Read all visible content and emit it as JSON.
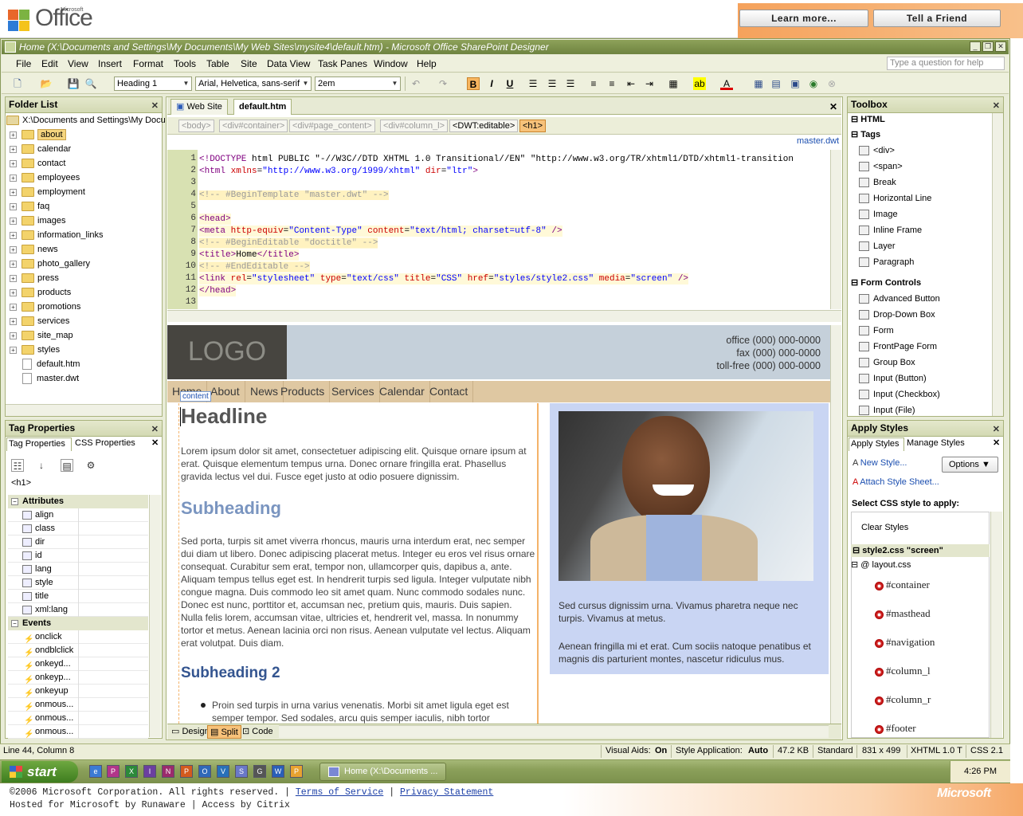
{
  "banner": {
    "logo_text": "Office",
    "logo_small": "Microsoft",
    "learn_more": "Learn more...",
    "tell_friend": "Tell a Friend"
  },
  "window": {
    "title": "Home (X:\\Documents and Settings\\My Documents\\My Web Sites\\mysite4\\default.htm) - Microsoft Office SharePoint Designer"
  },
  "menu": [
    "File",
    "Edit",
    "View",
    "Insert",
    "Format",
    "Tools",
    "Table",
    "Site",
    "Data View",
    "Task Panes",
    "Window",
    "Help"
  ],
  "help_placeholder": "Type a question for help",
  "toolbar": {
    "style": "Heading 1",
    "font": "Arial, Helvetica, sans-serif",
    "size": "2em"
  },
  "folder_list": {
    "title": "Folder List",
    "root": "X:\\Documents and Settings\\My Docu",
    "folders": [
      "about",
      "calendar",
      "contact",
      "employees",
      "employment",
      "faq",
      "images",
      "information_links",
      "news",
      "photo_gallery",
      "press",
      "products",
      "promotions",
      "services",
      "site_map",
      "styles"
    ],
    "files": [
      "default.htm",
      "master.dwt"
    ]
  },
  "tag_properties": {
    "title": "Tag Properties",
    "tab1": "Tag Properties",
    "tab2": "CSS Properties",
    "current_tag": "<h1>",
    "attributes_label": "Attributes",
    "attributes": [
      "align",
      "class",
      "dir",
      "id",
      "lang",
      "style",
      "title",
      "xml:lang"
    ],
    "events_label": "Events",
    "events": [
      "onclick",
      "ondblclick",
      "onkeyd...",
      "onkeyp...",
      "onkeyup",
      "onmous...",
      "onmous...",
      "onmous..."
    ]
  },
  "editor": {
    "tab_website": "Web Site",
    "tab_file": "default.htm",
    "crumbs": [
      "<body>",
      "<div#container>",
      "<div#page_content>",
      "<div#column_l>",
      "<DWT:editable>",
      "<h1>"
    ],
    "master_link": "master.dwt",
    "code_lines": [
      {
        "n": "1",
        "t": "<!DOCTYPE html PUBLIC \"-//W3C//DTD XHTML 1.0 Transitional//EN\" \"http://www.w3.org/TR/xhtml1/DTD/xhtml1-transition"
      },
      {
        "n": "2",
        "t": "<html xmlns=\"http://www.w3.org/1999/xhtml\" dir=\"ltr\">"
      },
      {
        "n": "3",
        "t": ""
      },
      {
        "n": "4",
        "t": "<!-- #BeginTemplate \"master.dwt\" -->"
      },
      {
        "n": "5",
        "t": ""
      },
      {
        "n": "6",
        "t": "<head>"
      },
      {
        "n": "7",
        "t": "<meta http-equiv=\"Content-Type\" content=\"text/html; charset=utf-8\" />"
      },
      {
        "n": "8",
        "t": "<!-- #BeginEditable \"doctitle\" -->"
      },
      {
        "n": "9",
        "t": "<title>Home</title>"
      },
      {
        "n": "10",
        "t": "<!-- #EndEditable -->"
      },
      {
        "n": "11",
        "t": "<link rel=\"stylesheet\" type=\"text/css\" title=\"CSS\" href=\"styles/style2.css\" media=\"screen\" />"
      },
      {
        "n": "12",
        "t": "</head>"
      },
      {
        "n": "13",
        "t": ""
      }
    ],
    "view_design": "Design",
    "view_split": "Split",
    "view_code": "Code"
  },
  "page": {
    "logo": "LOGO",
    "office": "office (000) 000-0000",
    "fax": "fax (000) 000-0000",
    "tollfree": "toll-free (000) 000-0000",
    "nav": [
      "Home",
      "About",
      "News",
      "Products",
      "Services",
      "Calendar",
      "Contact"
    ],
    "content_label": "content",
    "headline": "Headline",
    "p1": "Lorem ipsum dolor sit amet, consectetuer adipiscing elit. Quisque ornare ipsum at erat. Quisque elementum tempus urna. Donec ornare fringilla erat. Phasellus gravida lectus vel dui. Fusce eget justo at odio posuere dignissim.",
    "sub1": "Subheading",
    "p2": "Sed porta, turpis sit amet viverra rhoncus, mauris urna interdum erat, nec semper dui diam ut libero. Donec adipiscing placerat metus. Integer eu eros vel risus ornare consequat. Curabitur sem erat, tempor non, ullamcorper quis, dapibus a, ante. Aliquam tempus tellus eget est. In hendrerit turpis sed ligula. Integer vulputate nibh congue magna. Duis commodo leo sit amet quam. Nunc commodo sodales nunc. Donec est nunc, porttitor et, accumsan nec, pretium quis, mauris. Duis sapien. Nulla felis lorem, accumsan vitae, ultricies et, hendrerit vel, massa. In nonummy tortor et metus. Aenean lacinia orci non risus. Aenean vulputate vel lectus. Aliquam erat volutpat. Duis diam.",
    "sub2": "Subheading 2",
    "bullet": "Proin sed turpis in urna varius venenatis. Morbi sit amet ligula eget est semper tempor. Sed sodales, arcu quis semper iaculis, nibh tortor",
    "right_p1": "Sed cursus dignissim urna. Vivamus pharetra neque nec turpis. Vivamus at metus.",
    "right_p2": "Aenean fringilla mi et erat. Cum sociis natoque penatibus et magnis dis parturient montes, nascetur ridiculus mus."
  },
  "toolbox": {
    "title": "Toolbox",
    "html": "HTML",
    "tags_label": "Tags",
    "tags": [
      "<div>",
      "<span>",
      "Break",
      "Horizontal Line",
      "Image",
      "Inline Frame",
      "Layer",
      "Paragraph"
    ],
    "form_label": "Form Controls",
    "forms": [
      "Advanced Button",
      "Drop-Down Box",
      "Form",
      "FrontPage Form",
      "Group Box",
      "Input (Button)",
      "Input (Checkbox)",
      "Input (File)"
    ]
  },
  "apply_styles": {
    "title": "Apply Styles",
    "tab1": "Apply Styles",
    "tab2": "Manage Styles",
    "new_style": "New Style...",
    "options": "Options",
    "attach": "Attach Style Sheet...",
    "select_label": "Select CSS style to apply:",
    "clear": "Clear Styles",
    "sheet": "style2.css \"screen\"",
    "layout": "@ layout.css",
    "styles": [
      "#container",
      "#masthead",
      "#navigation",
      "#column_l",
      "#column_r",
      "#footer"
    ]
  },
  "status": {
    "position": "Line 44, Column 8",
    "visual_aids": "Visual Aids:",
    "visual_aids_val": "On",
    "style_app": "Style Application:",
    "style_app_val": "Auto",
    "size": "47.2 KB",
    "mode": "Standard",
    "dims": "831 x 499",
    "doctype": "XHTML 1.0 T",
    "css": "CSS 2.1"
  },
  "taskbar": {
    "start": "start",
    "task": "Home (X:\\Documents ...",
    "clock": "4:26 PM"
  },
  "footer": {
    "copyright": "©2006 Microsoft Corporation. All rights reserved. |",
    "tos": "Terms of Service",
    "sep": "|",
    "privacy": "Privacy Statement",
    "hosted": "Hosted for Microsoft by Runaware | Access by Citrix",
    "ms_logo": "Microsoft"
  }
}
